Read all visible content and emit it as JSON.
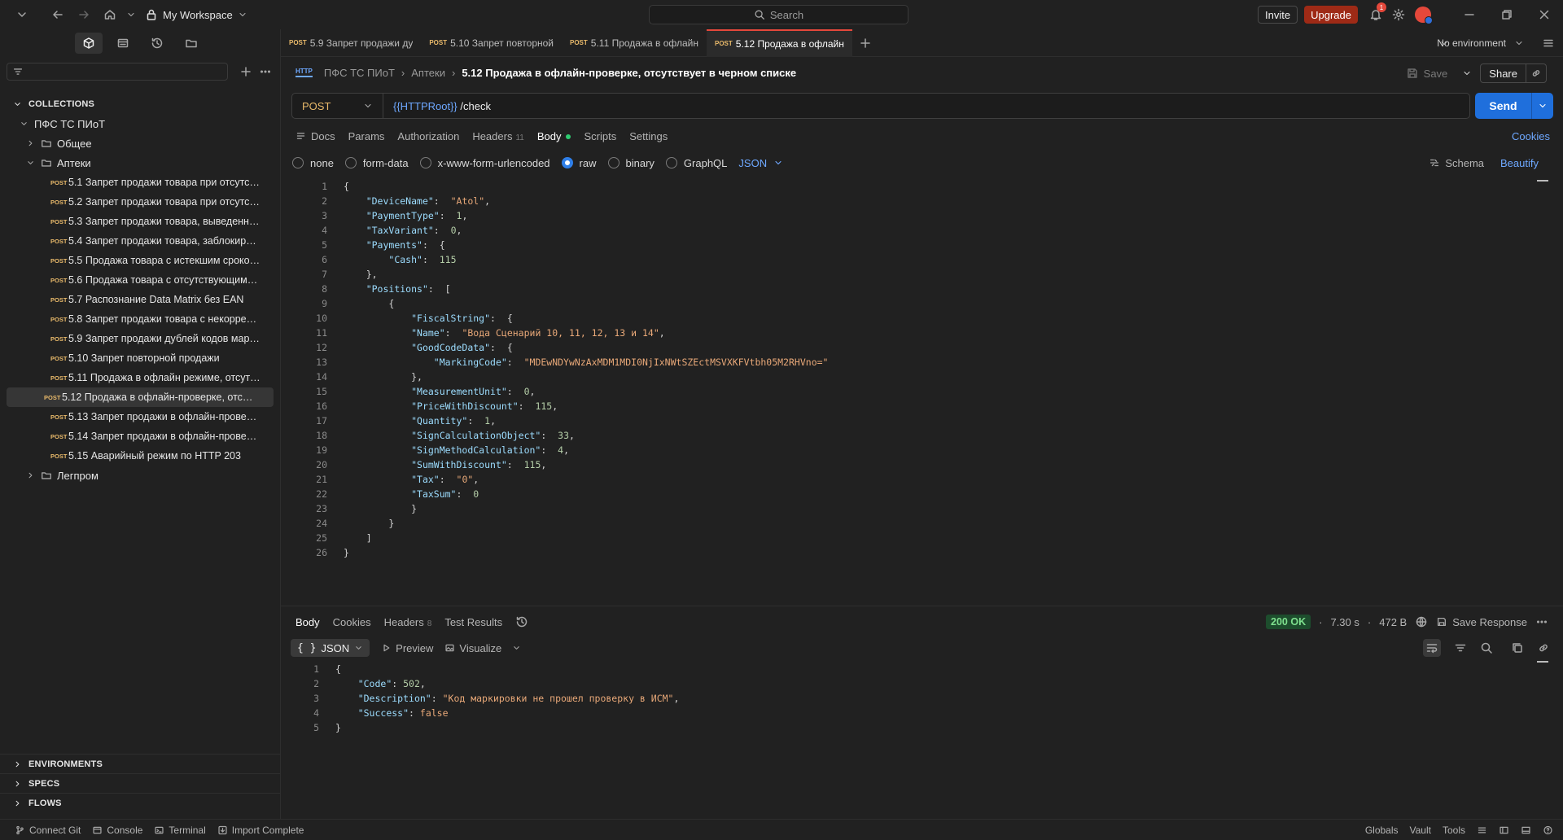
{
  "titlebar": {
    "workspace": "My Workspace",
    "search_placeholder": "Search",
    "invite": "Invite",
    "upgrade": "Upgrade",
    "notif_count": "1"
  },
  "sidebar": {
    "collections_label": "COLLECTIONS",
    "collection_name": "ПФС ТС ПИоТ",
    "folder_general": "Общее",
    "folder_pharmacy": "Аптеки",
    "method_tag": "POST",
    "requests": [
      "5.1 Запрет продажи товара при отсутстви...",
      "5.2 Запрет продажи товара при отсутств...",
      "5.3 Запрет продажи товара, выведенного...",
      "5.4 Запрет продажи товара, заблокирова...",
      "5.5 Продажа товара с истекшим сроком г...",
      "5.6 Продажа товара с отсутствующими с...",
      "5.7 Распознание Data Matrix без EAN",
      "5.8 Запрет продажи товара с некорректн...",
      "5.9 Запрет продажи дублей кодов марки...",
      "5.10 Запрет повторной продажи",
      "5.11 Продажа в офлайн режиме, отсутств...",
      "5.12 Продажа в офлайн-проверке, отсутс...",
      "5.13 Запрет продажи в офлайн-проверке,...",
      "5.14 Запрет продажи в офлайн-проверке ...",
      "5.15 Аварийный режим по HTTP 203"
    ],
    "folder_light": "Легпром",
    "environments": "ENVIRONMENTS",
    "specs": "SPECS",
    "flows": "FLOWS"
  },
  "tabs": [
    {
      "method": "POST",
      "name": "5.9 Запрет продажи ду"
    },
    {
      "method": "POST",
      "name": "5.10 Запрет повторной"
    },
    {
      "method": "POST",
      "name": "5.11 Продажа в офлайн"
    },
    {
      "method": "POST",
      "name": "5.12 Продажа в офлайн"
    }
  ],
  "environment": "No environment",
  "breadcrumb": {
    "collection": "ПФС ТС ПИоТ",
    "folder": "Аптеки",
    "current": "5.12 Продажа в офлайн-проверке, отсутствует в черном списке",
    "save": "Save",
    "share": "Share"
  },
  "request": {
    "method": "POST",
    "url_var": "{{HTTPRoot}}",
    "url_path": " /check",
    "send": "Send"
  },
  "req_tabs": {
    "docs": "Docs",
    "params": "Params",
    "authorization": "Authorization",
    "headers": "Headers",
    "headers_count": "11",
    "body": "Body",
    "scripts": "Scripts",
    "settings": "Settings",
    "cookies": "Cookies"
  },
  "body_types": {
    "none": "none",
    "form_data": "form-data",
    "urlencoded": "x-www-form-urlencoded",
    "raw": "raw",
    "binary": "binary",
    "graphql": "GraphQL",
    "json": "JSON",
    "schema": "Schema",
    "beautify": "Beautify"
  },
  "request_body": [
    "{",
    "    \"DeviceName\":  \"Atol\",",
    "    \"PaymentType\":  1,",
    "    \"TaxVariant\":  0,",
    "    \"Payments\":  {",
    "        \"Cash\":  115",
    "    },",
    "    \"Positions\":  [",
    "        {",
    "            \"FiscalString\":  {",
    "            \"Name\":  \"Вода Сценарий 10, 11, 12, 13 и 14\",",
    "            \"GoodCodeData\":  {",
    "                \"MarkingCode\":  \"MDEwNDYwNzAxMDM1MDI0NjIxNWtSZEctMSVXKFVtbh05M2RHVno=\"",
    "            },",
    "            \"MeasurementUnit\":  0,",
    "            \"PriceWithDiscount\":  115,",
    "            \"Quantity\":  1,",
    "            \"SignCalculationObject\":  33,",
    "            \"SignMethodCalculation\":  4,",
    "            \"SumWithDiscount\":  115,",
    "            \"Tax\":  \"0\",",
    "            \"TaxSum\":  0",
    "            }",
    "        }",
    "    ]",
    "}"
  ],
  "response": {
    "tabs": {
      "body": "Body",
      "cookies": "Cookies",
      "headers": "Headers",
      "headers_count": "8",
      "tests": "Test Results"
    },
    "status": "200 OK",
    "time": "7.30 s",
    "size": "472 B",
    "save_response": "Save Response",
    "format": "JSON",
    "preview": "Preview",
    "visualize": "Visualize",
    "body": [
      "{",
      "    \"Code\": 502,",
      "    \"Description\": \"Код маркировки не прошел проверку в ИСМ\",",
      "    \"Success\": false",
      "}"
    ]
  },
  "statusbar": {
    "connect_git": "Connect Git",
    "console": "Console",
    "terminal": "Terminal",
    "import_complete": "Import Complete",
    "globals": "Globals",
    "vault": "Vault",
    "tools": "Tools"
  }
}
